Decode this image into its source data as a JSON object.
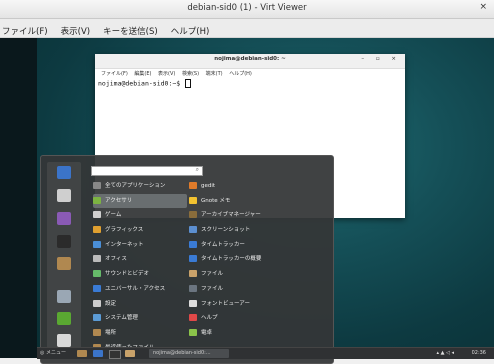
{
  "window": {
    "title": "debian-sid0 (1) - Virt Viewer",
    "close": "×",
    "menus": [
      "ファイル(F)",
      "表示(V)",
      "キーを送信(S)",
      "ヘルプ(H)"
    ]
  },
  "terminal": {
    "title": "nojima@debian-sid0: ~",
    "controls": "– ▫ ×",
    "menus": [
      "ファイル(F)",
      "編集(E)",
      "表示(V)",
      "検索(S)",
      "端末(T)",
      "ヘルプ(H)"
    ],
    "prompt": "nojima@debian-sid0:~$ "
  },
  "app_menu": {
    "search_placeholder": "",
    "categories": [
      {
        "label": "全てのアプリケーション",
        "icon": "apps-icon",
        "color": "#888888"
      },
      {
        "label": "アクセサリ",
        "icon": "accessories-icon",
        "color": "#7cb342"
      },
      {
        "label": "ゲーム",
        "icon": "games-icon",
        "color": "#cfcfcf"
      },
      {
        "label": "グラフィックス",
        "icon": "graphics-icon",
        "color": "#e0a030"
      },
      {
        "label": "インターネット",
        "icon": "internet-icon",
        "color": "#4a8fd8"
      },
      {
        "label": "オフィス",
        "icon": "office-icon",
        "color": "#bbbbbb"
      },
      {
        "label": "サウンドとビデオ",
        "icon": "sound-video-icon",
        "color": "#66bb6a"
      },
      {
        "label": "ユニバーサル・アクセス",
        "icon": "accessibility-icon",
        "color": "#3a7bd5"
      },
      {
        "label": "設定",
        "icon": "settings-icon",
        "color": "#cccccc"
      },
      {
        "label": "システム管理",
        "icon": "system-icon",
        "color": "#5b9bd5"
      },
      {
        "label": "場所",
        "icon": "places-icon",
        "color": "#b08850"
      },
      {
        "label": "最近使ったファイル",
        "icon": "recent-icon",
        "color": "#b08850"
      }
    ],
    "selected_category": 1,
    "apps": [
      {
        "label": "gedit",
        "icon": "gedit-icon",
        "color": "#e07b2a"
      },
      {
        "label": "Gnote メモ",
        "icon": "gnote-icon",
        "color": "#f2c230"
      },
      {
        "label": "アーカイブマネージャー",
        "icon": "archive-icon",
        "color": "#8a6d3b"
      },
      {
        "label": "スクリーンショット",
        "icon": "screenshot-icon",
        "color": "#5c8fd0"
      },
      {
        "label": "タイムトラッカー",
        "icon": "time-tracker-icon",
        "color": "#3a7bd5"
      },
      {
        "label": "タイムトラッカーの概要",
        "icon": "time-overview-icon",
        "color": "#3a7bd5"
      },
      {
        "label": "ファイル",
        "icon": "files-icon",
        "color": "#c9a26a"
      },
      {
        "label": "ファイル",
        "icon": "files-icon",
        "color": "#6b7580"
      },
      {
        "label": "フォントビューアー",
        "icon": "font-viewer-icon",
        "color": "#dddddd"
      },
      {
        "label": "ヘルプ",
        "icon": "help-icon",
        "color": "#e04848"
      },
      {
        "label": "電卓",
        "icon": "calculator-icon",
        "color": "#8bc34a"
      }
    ],
    "favorites": [
      {
        "name": "firefox-icon",
        "color": "#3b74c9"
      },
      {
        "name": "tools-icon",
        "color": "#cfcfcf"
      },
      {
        "name": "package-icon",
        "color": "#8a5ab5"
      },
      {
        "name": "terminal-icon",
        "color": "#2b2b2b"
      },
      {
        "name": "folder-icon",
        "color": "#b08850"
      },
      {
        "name": "monitor-icon",
        "color": "#9aa7b4"
      },
      {
        "name": "logout-icon",
        "color": "#5aa832"
      },
      {
        "name": "power-icon",
        "color": "#d8d8d8"
      }
    ]
  },
  "panel": {
    "menu_label": "メニュー",
    "task": "nojima@debian-sid0:...",
    "clock": "02:36"
  }
}
